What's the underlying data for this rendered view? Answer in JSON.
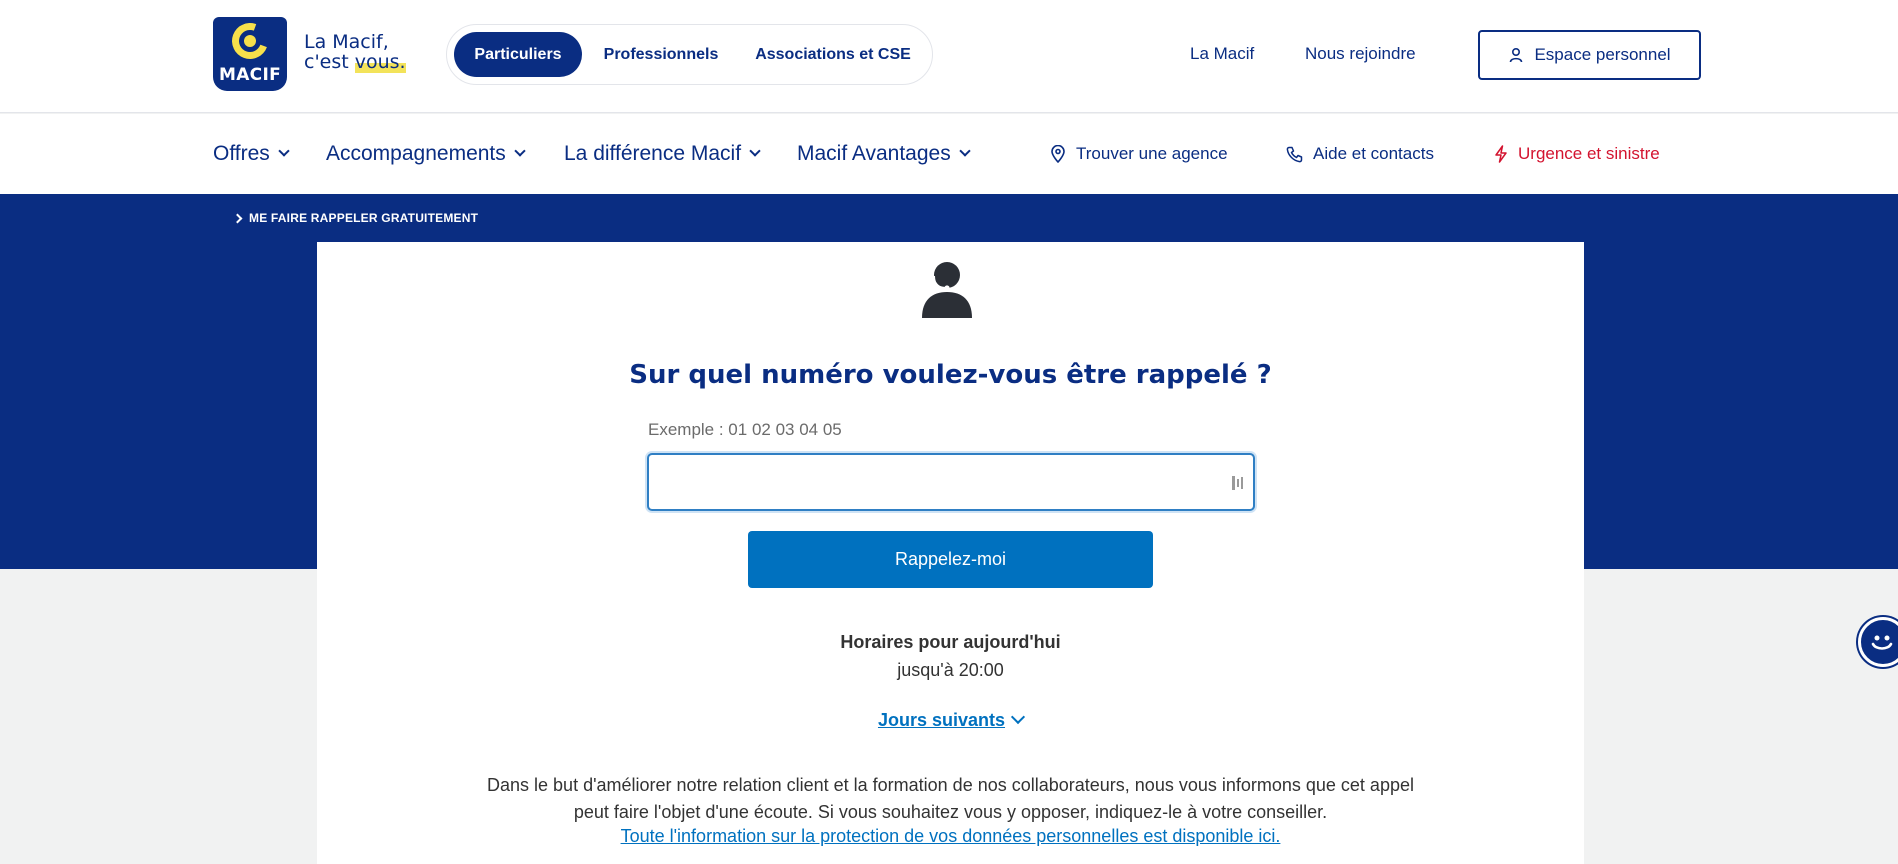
{
  "brand": {
    "logo_text": "MACIF",
    "tagline_line1": "La Macif,",
    "tagline_line2_prefix": "c'est ",
    "tagline_line2_highlight": "vous.",
    "primary_color": "#0a2d82",
    "accent_color": "#f7e04b"
  },
  "audience_tabs": [
    {
      "label": "Particuliers",
      "active": true
    },
    {
      "label": "Professionnels",
      "active": false
    },
    {
      "label": "Associations et CSE",
      "active": false
    }
  ],
  "top_links": {
    "la_macif": "La Macif",
    "nous_rejoindre": "Nous rejoindre",
    "espace_personnel": "Espace personnel"
  },
  "main_nav": [
    {
      "label": "Offres"
    },
    {
      "label": "Accompagnements"
    },
    {
      "label": "La différence Macif"
    },
    {
      "label": "Macif Avantages"
    }
  ],
  "utility_links": {
    "agence": "Trouver une agence",
    "aide": "Aide et contacts",
    "urgence": "Urgence et sinistre",
    "urgence_color": "#d3132f"
  },
  "breadcrumb": "ME FAIRE RAPPELER GRATUITEMENT",
  "callback": {
    "question": "Sur quel numéro voulez-vous être rappelé ?",
    "example": "Exemple : 01 02 03 04 05",
    "input_value": "",
    "button_label": "Rappelez-moi",
    "button_color": "#0071bf",
    "hours_title": "Horaires pour aujourd'hui",
    "hours_value": "jusqu'à 20:00",
    "next_days_link": "Jours suivants",
    "disclaimer_line1": "Dans le but d'améliorer notre relation client et la formation de nos collaborateurs, nous vous informons que cet appel",
    "disclaimer_line2": "peut faire l'objet d'une écoute. Si vous souhaitez vous y opposer, indiquez-le à votre conseiller.",
    "data_link": "Toute l'information sur la protection de vos données personnelles est disponible ici."
  }
}
